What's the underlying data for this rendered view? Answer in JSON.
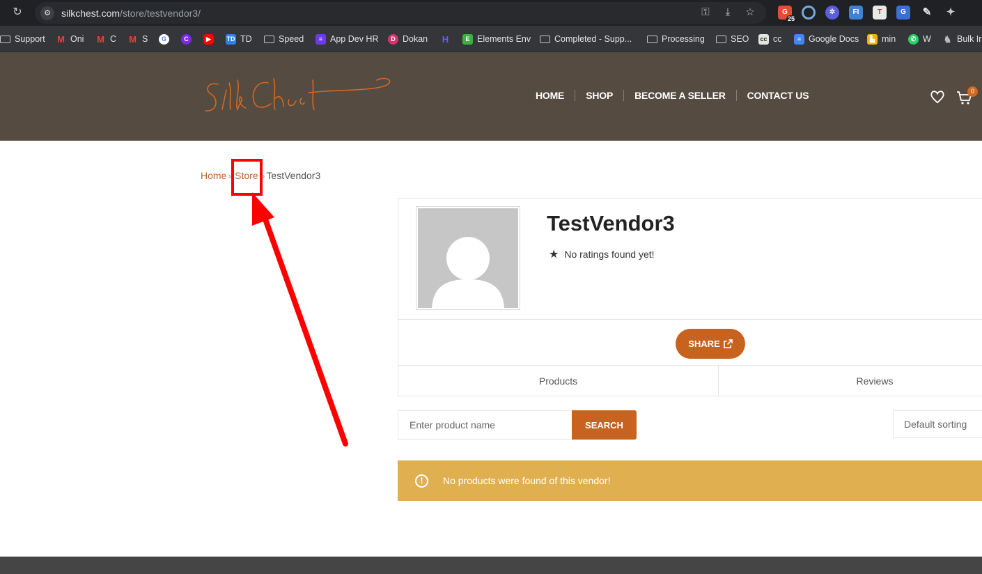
{
  "browser": {
    "url_host": "silkchest.com",
    "url_path": "/store/testvendor3/",
    "extension_badge": "25"
  },
  "bookmarks": [
    {
      "label": "Support",
      "icon": "folder-icon"
    },
    {
      "label": "Oni",
      "icon": "gmail-icon"
    },
    {
      "label": "C",
      "icon": "gmail-icon"
    },
    {
      "label": "S",
      "icon": "gmail-icon"
    },
    {
      "label": "",
      "icon": "google-icon"
    },
    {
      "label": "",
      "icon": "canva-icon"
    },
    {
      "label": "",
      "icon": "youtube-icon"
    },
    {
      "label": "TD",
      "icon": "td-icon"
    },
    {
      "label": "Speed",
      "icon": "folder-icon"
    },
    {
      "label": "App Dev HR",
      "icon": "list-icon"
    },
    {
      "label": "Dokan",
      "icon": "dokan-icon"
    },
    {
      "label": "",
      "icon": "h-icon"
    },
    {
      "label": "Elements Env",
      "icon": "elements-icon"
    },
    {
      "label": "Completed - Supp...",
      "icon": "folder-icon"
    },
    {
      "label": "Processing",
      "icon": "folder-icon"
    },
    {
      "label": "SEO",
      "icon": "folder-icon"
    },
    {
      "label": "cc",
      "icon": "cc-icon"
    },
    {
      "label": "Google Docs",
      "icon": "docs-icon"
    },
    {
      "label": "min",
      "icon": "min-icon"
    },
    {
      "label": "W",
      "icon": "whatsapp-icon"
    },
    {
      "label": "Bulk Ir",
      "icon": "elephant-icon"
    }
  ],
  "header": {
    "logo_text": "SilkChest",
    "nav": [
      "HOME",
      "SHOP",
      "BECOME A SELLER",
      "CONTACT US"
    ],
    "cart_count": "0"
  },
  "breadcrumb": {
    "home": "Home",
    "sep": "»",
    "store": "Store",
    "current": "TestVendor3"
  },
  "store": {
    "name": "TestVendor3",
    "rating_text": "No ratings found yet!",
    "share_label": "SHARE",
    "tabs": [
      "Products",
      "Reviews"
    ]
  },
  "search": {
    "placeholder": "Enter product name",
    "button_label": "SEARCH",
    "sort_label": "Default sorting"
  },
  "notice": {
    "text": "No products were found of this vendor!"
  },
  "colors": {
    "header_bg": "#564b40",
    "accent": "#c8631f",
    "notice_bg": "#e0b050",
    "annotation": "#ff0000"
  }
}
